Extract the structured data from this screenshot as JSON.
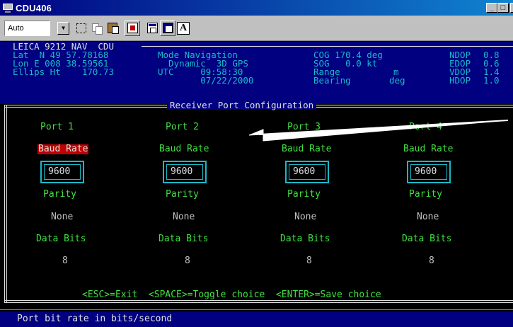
{
  "window": {
    "title": "CDU406",
    "btn_min": "_",
    "btn_max": "□",
    "btn_close": "x"
  },
  "toolbar": {
    "font_combo": "Auto",
    "font_button": "A"
  },
  "header": {
    "title": "LEICA 9212 NAV  CDU",
    "lat": "Lat  N 49 57.78168",
    "lon": "Lon E 008 38.59561",
    "height": "Ellips Ht    170.73",
    "mode": "Mode Navigation",
    "mode2": "  Dynamic  3D GPS",
    "utc": "UTC     09:58:30",
    "date": "        07/22/2000",
    "cog": "COG 170.4 deg",
    "sog": "SOG   0.0 kt",
    "range_label": "Range",
    "range_unit": "m",
    "bearing_label": "Bearing",
    "bearing_unit": "deg",
    "ndop_label": "NDOP",
    "ndop": "0.8",
    "edop_label": "EDOP",
    "edop": "0.6",
    "vdop_label": "VDOP",
    "vdop": "1.4",
    "hdop_label": "HDOP",
    "hdop": "1.0"
  },
  "panel": {
    "title": "Receiver Port Configuration",
    "ports": [
      {
        "name": "Port 1",
        "baud_label": "Baud Rate",
        "baud": "9600",
        "parity_label": "Parity",
        "parity": "None",
        "data_bits_label": "Data Bits",
        "data_bits": "8"
      },
      {
        "name": "Port 2",
        "baud_label": "Baud Rate",
        "baud": "9600",
        "parity_label": "Parity",
        "parity": "None",
        "data_bits_label": "Data Bits",
        "data_bits": "8"
      },
      {
        "name": "Port 3",
        "baud_label": "Baud Rate",
        "baud": "9600",
        "parity_label": "Parity",
        "parity": "None",
        "data_bits_label": "Data Bits",
        "data_bits": "8"
      },
      {
        "name": "Port 4",
        "baud_label": "Baud Rate",
        "baud": "9600",
        "parity_label": "Parity",
        "parity": "None",
        "data_bits_label": "Data Bits",
        "data_bits": "8"
      }
    ],
    "keys": "<ESC>=Exit  <SPACE>=Toggle choice  <ENTER>=Save choice"
  },
  "status": {
    "text": "Port bit rate in bits/second"
  },
  "colors": {
    "titlebar": "#000080",
    "terminal_bg": "#000000",
    "label_green": "#40e040",
    "cyan": "#1ab8c8",
    "highlight_red": "#c00000",
    "status_blue": "#000080"
  }
}
